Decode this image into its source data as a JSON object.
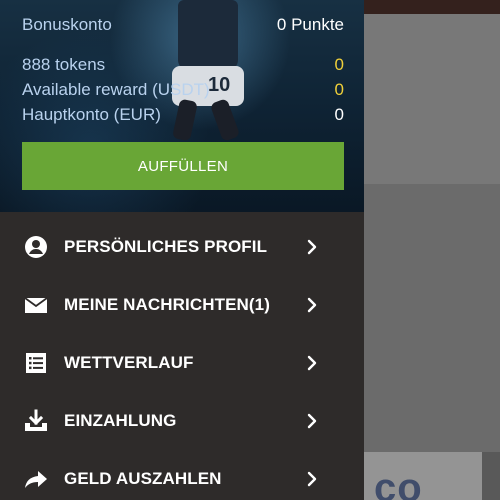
{
  "account": {
    "bonus_label": "Bonuskonto",
    "bonus_value": "0 Punkte",
    "tokens_label": "888 tokens",
    "tokens_value": "0",
    "reward_label": "Available reward (USDT)",
    "reward_value": "0",
    "main_label": "Hauptkonto (EUR)",
    "main_value": "0"
  },
  "topup_button": {
    "label": "AUFFÜLLEN"
  },
  "menu": {
    "items": [
      {
        "label": "PERSÖNLICHES PROFIL",
        "icon": "user-circle-icon"
      },
      {
        "label": "MEINE NACHRICHTEN(1)",
        "icon": "envelope-icon"
      },
      {
        "label": "WETTVERLAUF",
        "icon": "list-icon"
      },
      {
        "label": "EINZAHLUNG",
        "icon": "download-tray-icon"
      },
      {
        "label": "GELD AUSZAHLEN",
        "icon": "share-arrow-icon"
      }
    ]
  },
  "colors": {
    "drawer_bg": "#2e2b2a",
    "topup_green": "#69a636",
    "label_blue": "#b9d2ee",
    "value_gold": "#f0d03a"
  }
}
